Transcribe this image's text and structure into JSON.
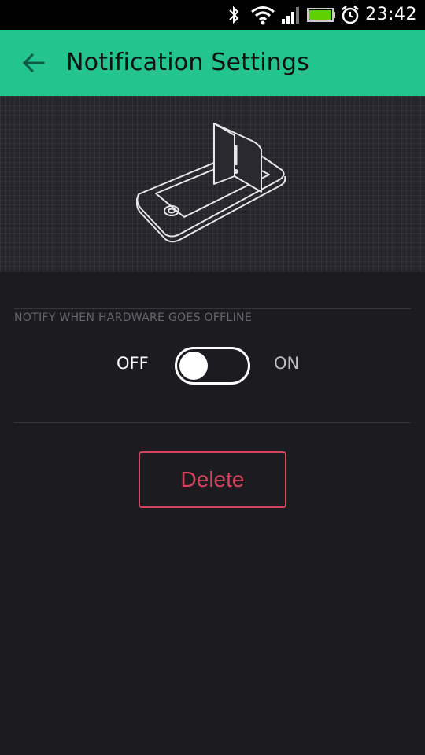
{
  "status_bar": {
    "time": "23:42",
    "icons": [
      "bluetooth-icon",
      "wifi-icon",
      "signal-icon",
      "battery-icon",
      "alarm-icon"
    ],
    "battery_color": "#5fd000"
  },
  "app_bar": {
    "title": "Notification Settings",
    "background": "#23c48e",
    "back_icon": "arrow-left-icon"
  },
  "hero": {
    "illustration": "phone-notification-icon"
  },
  "settings": {
    "section_label": "NOTIFY WHEN HARDWARE GOES OFFLINE",
    "toggle": {
      "off_label": "OFF",
      "on_label": "ON",
      "state": "off"
    }
  },
  "actions": {
    "delete_label": "Delete",
    "delete_color": "#d3435c"
  }
}
